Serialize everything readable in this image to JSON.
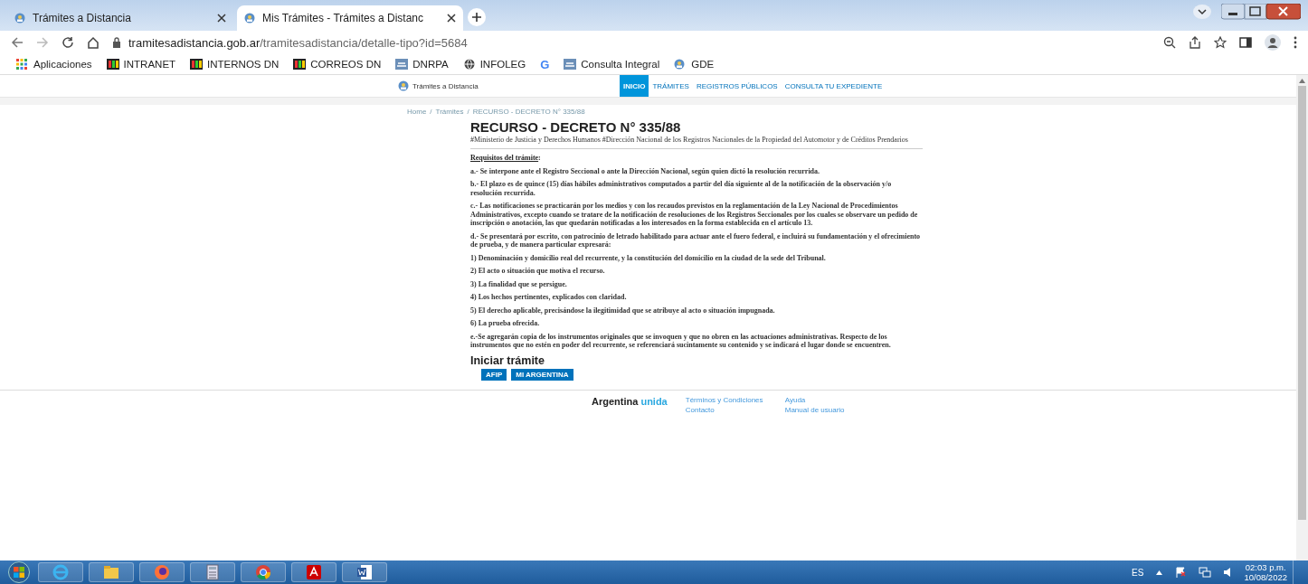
{
  "browser": {
    "tabs": [
      {
        "title": "Trámites a Distancia",
        "selected": false
      },
      {
        "title": "Mis Trámites - Trámites a Distanc",
        "selected": true
      }
    ],
    "address": {
      "host": "tramitesadistancia.gob.ar",
      "path": "/tramitesadistancia/detalle-tipo?id=5684"
    },
    "bookmarks": [
      {
        "label": "Aplicaciones",
        "kind": "apps"
      },
      {
        "label": "INTRANET",
        "kind": "logo"
      },
      {
        "label": "INTERNOS DN",
        "kind": "logo"
      },
      {
        "label": "CORREOS DN",
        "kind": "logo"
      },
      {
        "label": "DNRPA",
        "kind": "seal"
      },
      {
        "label": "INFOLEG",
        "kind": "globe"
      },
      {
        "label": "G",
        "kind": "letter"
      },
      {
        "label": "Consulta Integral",
        "kind": "seal"
      },
      {
        "label": "GDE",
        "kind": "shield"
      }
    ]
  },
  "site": {
    "brand": "Trámites a Distancia",
    "nav": [
      {
        "label": "INICIO",
        "selected": true
      },
      {
        "label": "TRÁMITES",
        "selected": false
      },
      {
        "label": "REGISTROS PÚBLICOS",
        "selected": false
      },
      {
        "label": "CONSULTA TU EXPEDIENTE",
        "selected": false
      }
    ],
    "breadcrumb": [
      "Home",
      "/",
      "Trámites",
      "/",
      "RECURSO - DECRETO N° 335/88"
    ],
    "title": "RECURSO - DECRETO N° 335/88",
    "tags": "#Ministerio de Justicia y Derechos Humanos #Dirección Nacional de los Registros Nacionales de la Propiedad del Automotor y de Créditos Prendarios",
    "requirements": {
      "heading": "Requisitos del trámite",
      "suffix": ":"
    },
    "paragraphs": [
      "a.- Se interpone ante el Registro Seccional o ante la Dirección Nacional, según quien dictó la resolución recurrida.",
      "b.- El plazo es de quince (15) días hábiles administrativos computados a partir del día siguiente al de la notificación de la observación y/o resolución recurrida.",
      "c.- Las notificaciones se practicarán por los medios y con los recaudos previstos en la reglamentación de la Ley Nacional de Procedimientos Administrativos, excepto cuando se tratare de la notificación de resoluciones de los Registros Seccionales por los cuales se observare un pedido de inscripción o anotación, las que quedarán notificadas a los interesados en la forma establecida en el artículo 13.",
      "d.- Se presentará por escrito, con patrocinio de letrado habilitado para actuar ante el fuero federal, e incluirá su fundamentación y el ofrecimiento de prueba, y de manera particular expresará:",
      "1) Denominación y domicilio real del recurrente, y la constitución del domicilio en la ciudad de la sede del Tribunal.",
      "2) El acto o situación que motiva el recurso.",
      "3) La finalidad que se persigue.",
      "4) Los hechos pertinentes, explicados con claridad.",
      "5) El derecho aplicable, precisándose la ilegitimidad que se atribuye al acto o situación impugnada.",
      "6) La prueba ofrecida.",
      "e.-Se agregarán copia de los instrumentos originales que se invoquen y que no obren en las actuaciones administrativas. Respecto de los instrumentos que no estén en poder del recurrente, se referenciará sucintamente su contenido y se indicará el lugar donde se encuentren."
    ],
    "start": {
      "heading": "Iniciar trámite",
      "buttons": [
        "AFIP",
        "MI ARGENTINA"
      ]
    },
    "footer": {
      "brand": "Argentina",
      "brand_accent": "unida",
      "links": [
        "Términos y Condiciones",
        "Ayuda",
        "Contacto",
        "Manual de usuario"
      ]
    }
  },
  "taskbar": {
    "apps": [
      {
        "kind": "start"
      },
      {
        "kind": "ie"
      },
      {
        "kind": "explorer"
      },
      {
        "kind": "firefox"
      },
      {
        "kind": "calculator"
      },
      {
        "kind": "chrome"
      },
      {
        "kind": "acrobat"
      },
      {
        "kind": "word"
      }
    ],
    "language": "ES",
    "time": "02:03 p.m.",
    "date": "10/08/2022"
  }
}
